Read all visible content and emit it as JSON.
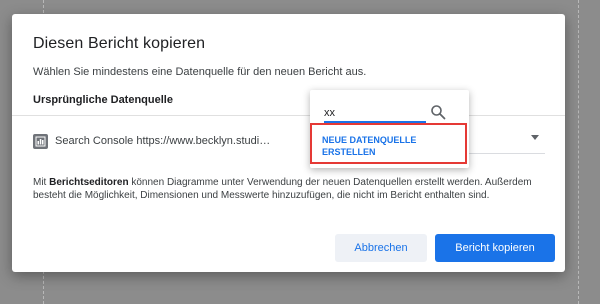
{
  "dialog": {
    "title": "Diesen Bericht kopieren",
    "subtitle": "Wählen Sie mindestens eine Datenquelle für den neuen Bericht aus.",
    "section_label": "Ursprüngliche Datenquelle",
    "original_source": "Search Console https://www.becklyn.studi…",
    "note_bold": "Berichtseditoren",
    "note_prefix": "Mit ",
    "note_rest": " können Diagramme unter Verwendung der neuen Datenquellen erstellt werden. Außerdem besteht die Möglichkeit, Dimensionen und Messwerte hinzuzufügen, die nicht im Bericht enthalten sind.",
    "cancel_label": "Abbrechen",
    "copy_label": "Bericht kopieren"
  },
  "dropdown": {
    "search_value": "xx",
    "new_source_label": "NEUE DATENQUELLE ERSTELLEN",
    "search_icon": "search-icon"
  },
  "colors": {
    "accent": "#1a73e8",
    "highlight": "#e53935",
    "backdrop": "#8c8c8c"
  }
}
